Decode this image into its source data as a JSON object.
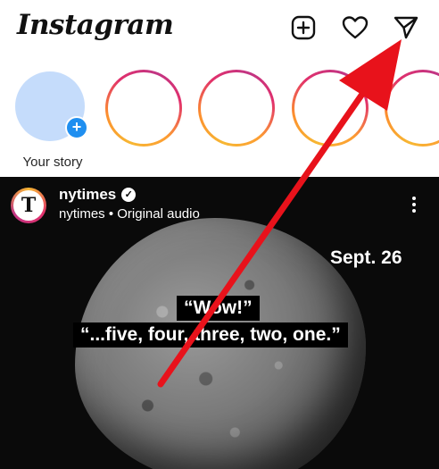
{
  "header": {
    "logo": "Instagram",
    "icons": [
      "new-post-icon",
      "heart-icon",
      "direct-message-icon"
    ]
  },
  "stories": {
    "your_story_label": "Your story",
    "plus": "+",
    "count_visible": 5
  },
  "post": {
    "username": "nytimes",
    "verified_mark": "✓",
    "subtitle": "nytimes • Original audio",
    "avatar_glyph": "T",
    "date_overlay": "Sept. 26",
    "caption_line1": "“Wow!”",
    "caption_line2": "“...five, four, three, two, one.”"
  },
  "colors": {
    "annotation_arrow": "#e8121b",
    "plus_badge": "#1f8ff0",
    "your_story_avatar": "#c5dcfb"
  }
}
